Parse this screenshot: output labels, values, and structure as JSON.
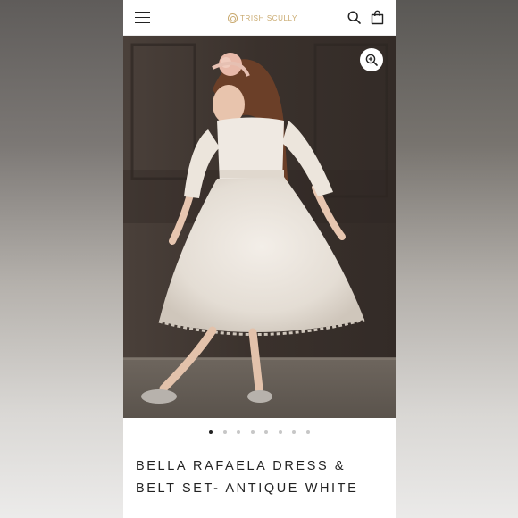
{
  "header": {
    "brand": "TRISH SCULLY",
    "icons": [
      "menu-icon",
      "search-icon",
      "bag-icon"
    ]
  },
  "gallery": {
    "slide_count": 8,
    "active_slide": 1,
    "zoom_icon": "zoom-in-icon"
  },
  "product": {
    "title_line1": "BELLA RAFAELA DRESS &",
    "title_line2": "BELT SET- ANTIQUE WHITE"
  },
  "colors": {
    "brand_gold": "#c9a96e",
    "text": "#222222"
  }
}
